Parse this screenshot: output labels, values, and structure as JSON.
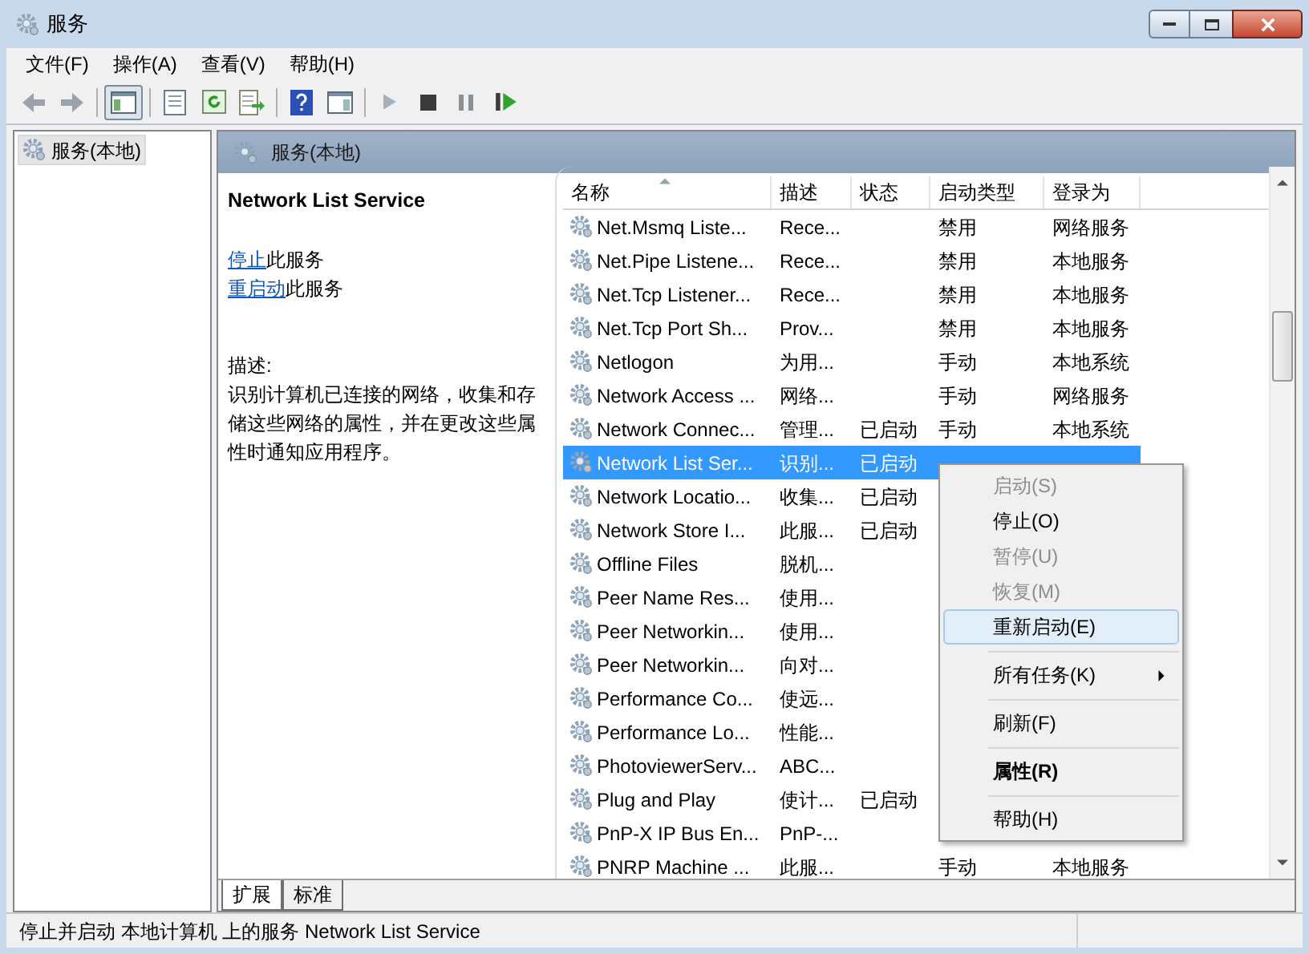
{
  "window": {
    "title": "服务"
  },
  "menu": [
    "文件(F)",
    "操作(A)",
    "查看(V)",
    "帮助(H)"
  ],
  "tree": {
    "items": [
      {
        "label": "服务(本地)",
        "selected": true
      }
    ]
  },
  "panel": {
    "title": "服务(本地)"
  },
  "details": {
    "service_name": "Network List Service",
    "actions": [
      {
        "link": "停止",
        "text": "此服务"
      },
      {
        "link": "重启动",
        "text": "此服务"
      }
    ],
    "description_label": "描述:",
    "description": "识别计算机已连接的网络，收集和存储这些网络的属性，并在更改这些属性时通知应用程序。"
  },
  "table": {
    "columns": [
      "名称",
      "描述",
      "状态",
      "启动类型",
      "登录为"
    ],
    "rows": [
      {
        "name": "Net.Msmq Liste...",
        "desc": "Rece...",
        "status": "",
        "startup": "禁用",
        "logon": "网络服务",
        "selected": false
      },
      {
        "name": "Net.Pipe Listene...",
        "desc": "Rece...",
        "status": "",
        "startup": "禁用",
        "logon": "本地服务",
        "selected": false
      },
      {
        "name": "Net.Tcp Listener...",
        "desc": "Rece...",
        "status": "",
        "startup": "禁用",
        "logon": "本地服务",
        "selected": false
      },
      {
        "name": "Net.Tcp Port Sh...",
        "desc": "Prov...",
        "status": "",
        "startup": "禁用",
        "logon": "本地服务",
        "selected": false
      },
      {
        "name": "Netlogon",
        "desc": "为用...",
        "status": "",
        "startup": "手动",
        "logon": "本地系统",
        "selected": false
      },
      {
        "name": "Network Access ...",
        "desc": "网络...",
        "status": "",
        "startup": "手动",
        "logon": "网络服务",
        "selected": false
      },
      {
        "name": "Network Connec...",
        "desc": "管理...",
        "status": "已启动",
        "startup": "手动",
        "logon": "本地系统",
        "selected": false
      },
      {
        "name": "Network List Ser...",
        "desc": "识别...",
        "status": "已启动",
        "selected": true
      },
      {
        "name": "Network Locatio...",
        "desc": "收集...",
        "status": "已启动",
        "selected": false
      },
      {
        "name": "Network Store I...",
        "desc": "此服...",
        "status": "已启动",
        "selected": false
      },
      {
        "name": "Offline Files",
        "desc": "脱机...",
        "status": "",
        "selected": false
      },
      {
        "name": "Peer Name Res...",
        "desc": "使用...",
        "status": "",
        "selected": false
      },
      {
        "name": "Peer Networkin...",
        "desc": "使用...",
        "status": "",
        "selected": false
      },
      {
        "name": "Peer Networkin...",
        "desc": "向对...",
        "status": "",
        "selected": false
      },
      {
        "name": "Performance Co...",
        "desc": "使远...",
        "status": "",
        "selected": false
      },
      {
        "name": "Performance Lo...",
        "desc": "性能...",
        "status": "",
        "selected": false
      },
      {
        "name": "PhotoviewerServ...",
        "desc": "ABC...",
        "status": "",
        "selected": false
      },
      {
        "name": "Plug and Play",
        "desc": "使计...",
        "status": "已启动",
        "selected": false
      },
      {
        "name": "PnP-X IP Bus En...",
        "desc": "PnP-...",
        "status": "",
        "selected": false
      },
      {
        "name": "PNRP Machine ...",
        "desc": "此服...",
        "status": "",
        "startup": "手动",
        "logon": "本地服务",
        "selected": false
      }
    ]
  },
  "context_menu": [
    {
      "kind": "item",
      "label": "启动(S)",
      "disabled": true,
      "highlighted": false
    },
    {
      "kind": "item",
      "label": "停止(O)",
      "disabled": false,
      "highlighted": false
    },
    {
      "kind": "item",
      "label": "暂停(U)",
      "disabled": true,
      "highlighted": false
    },
    {
      "kind": "item",
      "label": "恢复(M)",
      "disabled": true,
      "highlighted": false
    },
    {
      "kind": "item",
      "label": "重新启动(E)",
      "disabled": false,
      "highlighted": true
    },
    {
      "kind": "separator"
    },
    {
      "kind": "submenu",
      "label": "所有任务(K)",
      "disabled": false,
      "highlighted": false
    },
    {
      "kind": "separator"
    },
    {
      "kind": "item",
      "label": "刷新(F)",
      "disabled": false,
      "highlighted": false
    },
    {
      "kind": "separator"
    },
    {
      "kind": "default",
      "label": "属性(R)",
      "disabled": false,
      "highlighted": false
    },
    {
      "kind": "separator"
    },
    {
      "kind": "item",
      "label": "帮助(H)",
      "disabled": false,
      "highlighted": false
    }
  ],
  "view_tabs": [
    {
      "label": "扩展",
      "selected": true
    },
    {
      "label": "标准",
      "selected": false
    }
  ],
  "status_bar": "停止并启动 本地计算机 上的服务 Network List Service"
}
